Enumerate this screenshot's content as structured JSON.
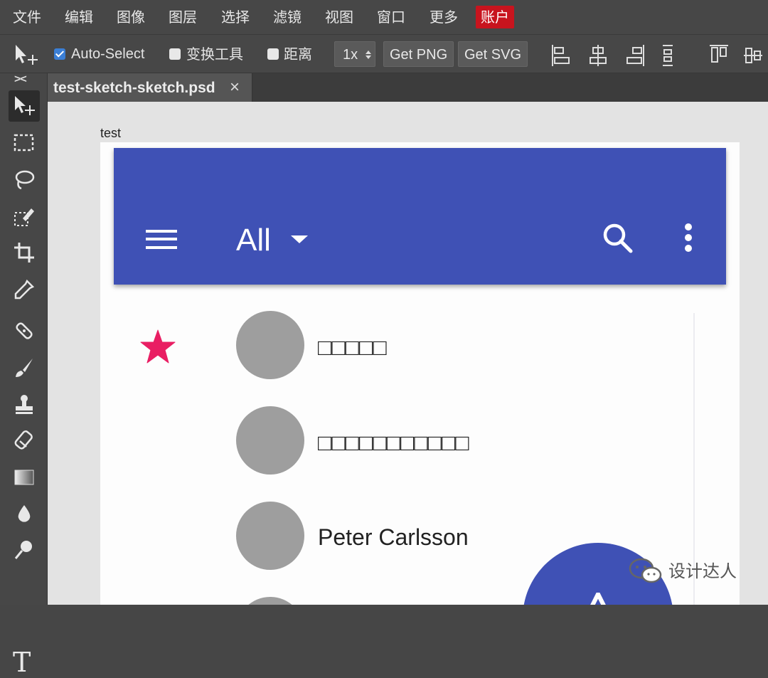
{
  "menu": {
    "items": [
      "文件",
      "编辑",
      "图像",
      "图层",
      "选择",
      "滤镜",
      "视图",
      "窗口",
      "更多"
    ],
    "account": "账户",
    "account_color": "#c8141e"
  },
  "options": {
    "auto_select_label": "Auto-Select",
    "auto_select_checked": true,
    "transform_label": "变换工具",
    "transform_checked": false,
    "distance_label": "距离",
    "distance_checked": false,
    "scale_value": "1x",
    "get_png_label": "Get PNG",
    "get_svg_label": "Get SVG"
  },
  "tools": {
    "collapse_label": "><",
    "type_tool_label": "T",
    "items": [
      "move-tool",
      "marquee-tool",
      "lasso-tool",
      "quick-select-tool",
      "crop-tool",
      "eyedropper-tool",
      "healing-tool",
      "brush-tool",
      "stamp-tool",
      "eraser-tool",
      "gradient-tool",
      "blur-tool",
      "dodge-tool",
      "type-tool"
    ]
  },
  "document": {
    "tab_label": "test-sketch-sketch.psd",
    "close_glyph": "×",
    "artboard_label": "test"
  },
  "app": {
    "primary_color": "#3f51b5",
    "accent_color": "#e91e63",
    "filter_label": "All",
    "contacts": [
      {
        "name": "□□□□□",
        "starred": true
      },
      {
        "name": "□□□□□□□□□□□",
        "starred": false
      },
      {
        "name": "Peter Carlsson",
        "starred": false
      }
    ]
  },
  "watermark": {
    "text": "设计达人",
    "icon": "wechat-icon"
  }
}
